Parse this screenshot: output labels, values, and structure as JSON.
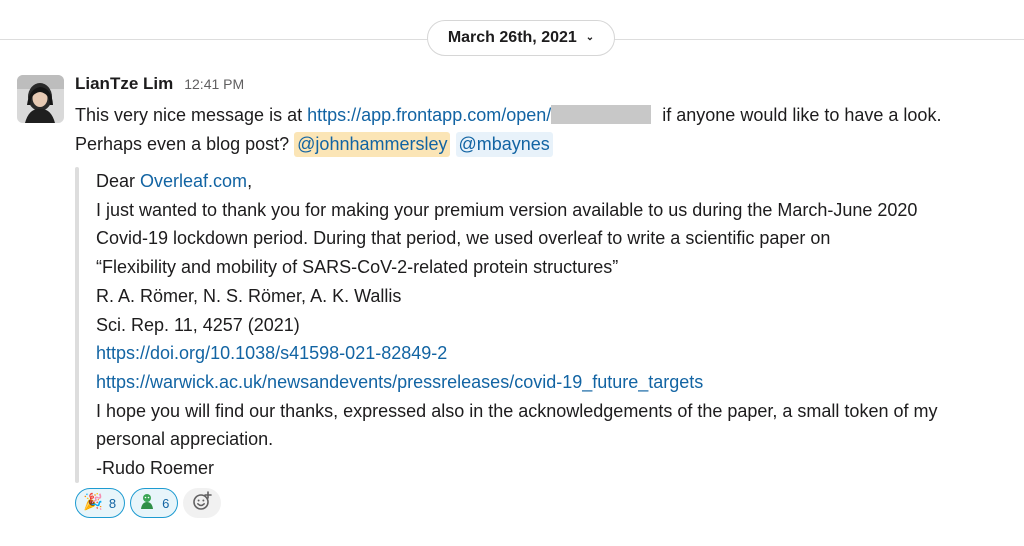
{
  "date_divider": {
    "label": "March 26th, 2021",
    "chevron": "chevron-down-icon"
  },
  "message": {
    "sender": "LianTze Lim",
    "timestamp": "12:41 PM",
    "text_part1": "This very nice message is at ",
    "link_url": "https://app.frontapp.com/open/",
    "text_part2": " if anyone would like to have a look.",
    "text_part3": "Perhaps even a blog post? ",
    "mention1": "@johnhammersley",
    "mention2": "@mbaynes"
  },
  "quote": {
    "dear": "Dear ",
    "overleaf_link": "Overleaf.com",
    "comma": ",",
    "line2": "I just wanted to thank you for making your premium version available to us during the March-June 2020",
    "line3": "Covid-19 lockdown period. During that period, we used overleaf to write a scientific paper on",
    "line4": "“Flexibility and mobility of SARS-CoV-2-related protein structures”",
    "line5": "R. A. Römer, N. S. Römer, A. K. Wallis",
    "line6": "Sci. Rep. 11, 4257 (2021)",
    "link_doi": "https://doi.org/10.1038/s41598-021-82849-2",
    "link_warwick": "https://warwick.ac.uk/newsandevents/pressreleases/covid-19_future_targets",
    "line9": "I hope you will find our thanks, expressed also in the acknowledgements of the paper, a small token of my",
    "line10": "personal appreciation.",
    "line11": "-Rudo Roemer"
  },
  "reactions": [
    {
      "emoji": "🎉",
      "icon": "party-popper-icon",
      "count": "8"
    },
    {
      "emoji": "🐍",
      "icon": "green-emoji-icon",
      "count": "6"
    }
  ],
  "add_reaction_icon": "add-reaction-icon",
  "colors": {
    "link": "#1264a3",
    "mention_self_bg": "#fbe5b6",
    "mention_bg": "#e8f2fa",
    "reaction_border": "#1d9bd1"
  }
}
